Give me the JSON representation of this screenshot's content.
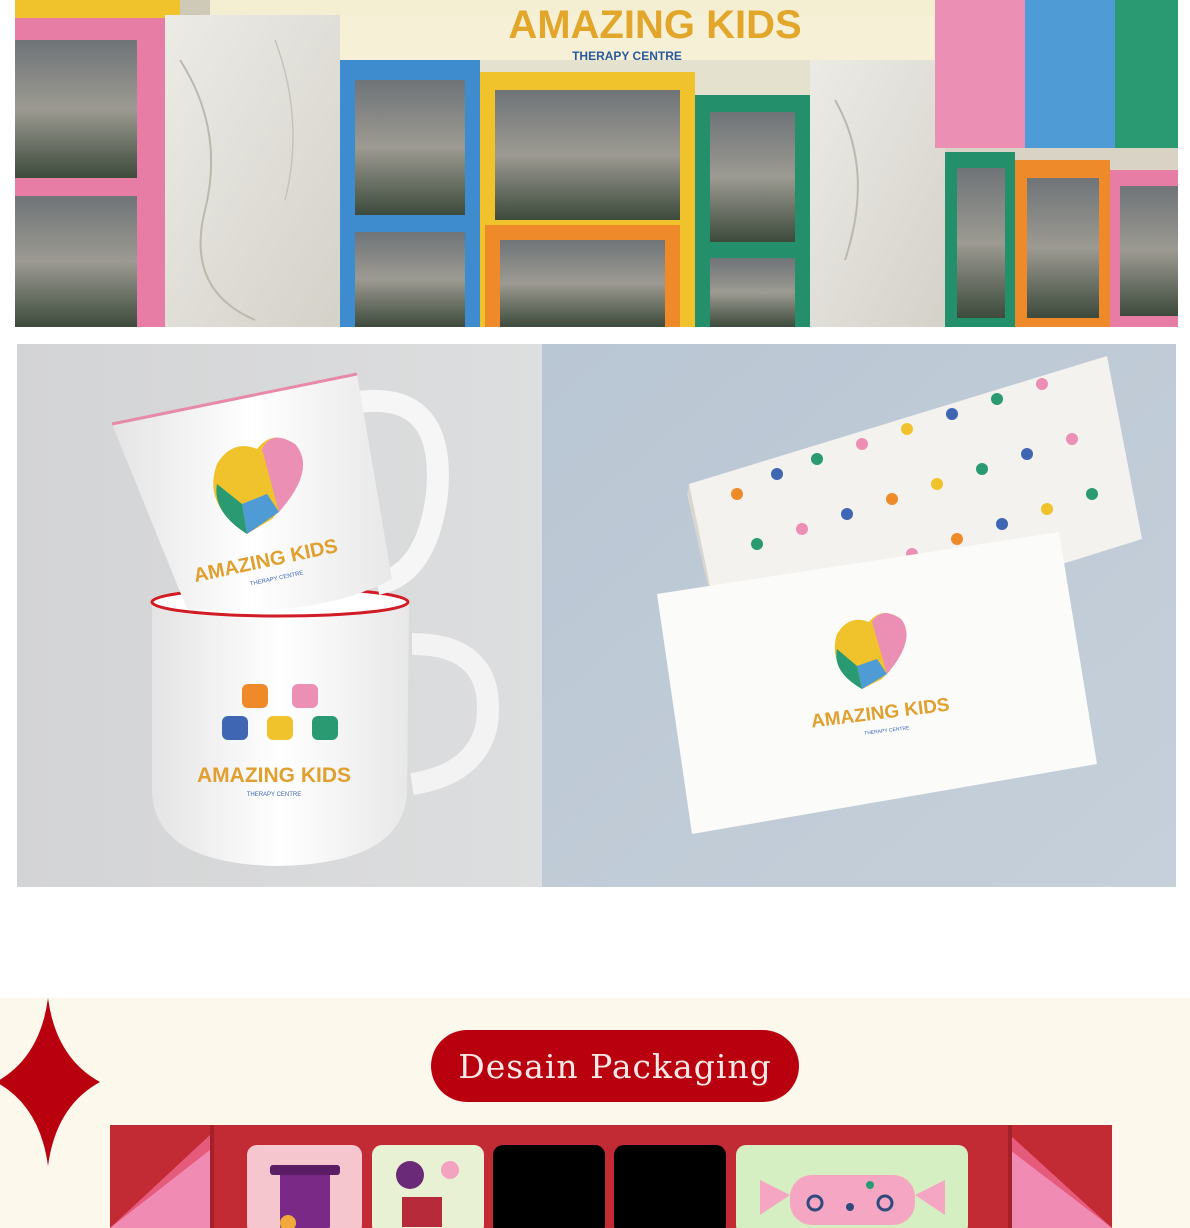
{
  "storefront": {
    "brand_name": "AMAZING KIDS",
    "brand_subtitle": "THERAPY CENTRE"
  },
  "mockups": {
    "mug_top_brand": "AMAZING KIDS",
    "mug_top_subtitle": "THERAPY CENTRE",
    "mug_bottom_brand": "AMAZING KIDS",
    "mug_bottom_subtitle": "THERAPY CENTRE",
    "card_brand": "AMAZING KIDS",
    "card_subtitle": "THERAPY CENTRE"
  },
  "packaging": {
    "section_title": "Desain Packaging"
  },
  "colors": {
    "accent_red": "#b8000e",
    "section_bg": "#fdf8ec",
    "pink": "#ec8fb5",
    "blue": "#4e9bd6",
    "green": "#2a9a72",
    "yellow": "#f0c22c",
    "orange": "#ef8a2a"
  }
}
